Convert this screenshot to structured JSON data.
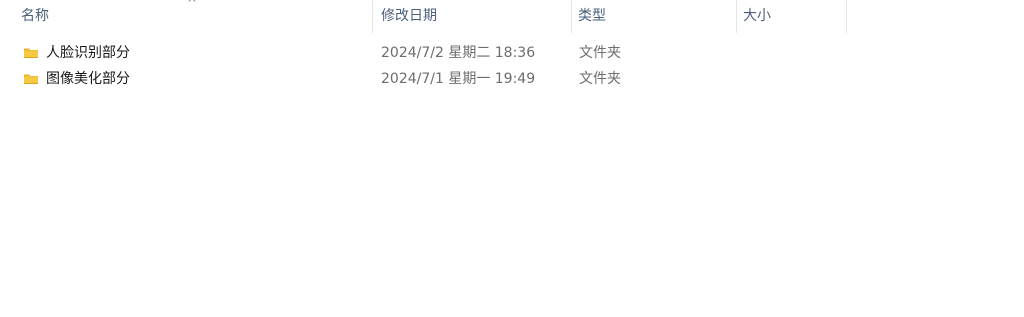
{
  "columns": {
    "name": "名称",
    "modified": "修改日期",
    "type": "类型",
    "size": "大小"
  },
  "sort": {
    "column": "name",
    "direction": "ascending",
    "indicator": "^"
  },
  "files": [
    {
      "name": "人脸识别部分",
      "modified": "2024/7/2 星期二 18:36",
      "type": "文件夹",
      "icon": "folder-icon"
    },
    {
      "name": "图像美化部分",
      "modified": "2024/7/1 星期一 19:49",
      "type": "文件夹",
      "icon": "folder-icon"
    }
  ],
  "colors": {
    "header_text": "#4c607a",
    "name_text": "#1a1a1a",
    "secondary_text": "#6d6d6d",
    "folder_yellow": "#f6c943"
  }
}
